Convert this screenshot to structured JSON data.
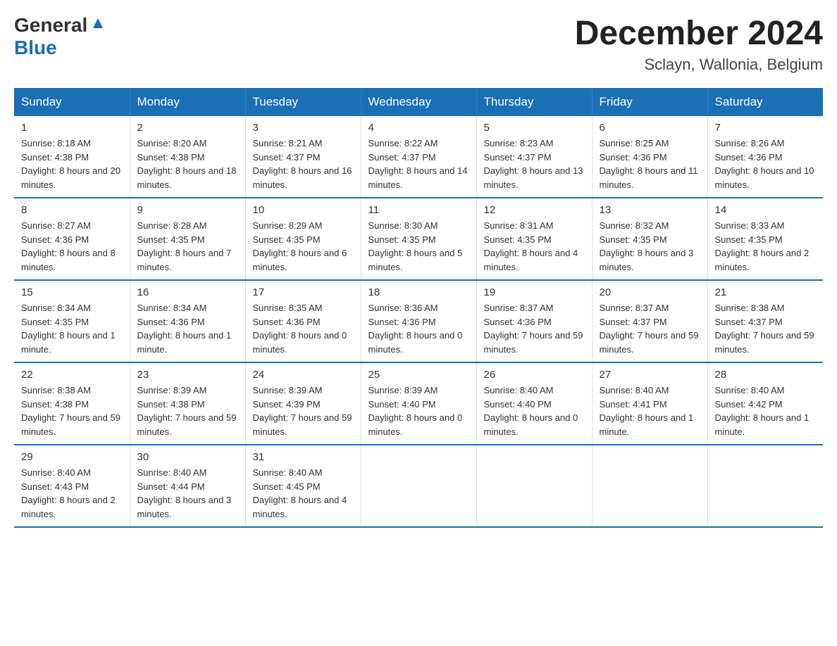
{
  "header": {
    "logo_text_general": "General",
    "logo_text_blue": "Blue",
    "month_year": "December 2024",
    "location": "Sclayn, Wallonia, Belgium"
  },
  "days_of_week": [
    "Sunday",
    "Monday",
    "Tuesday",
    "Wednesday",
    "Thursday",
    "Friday",
    "Saturday"
  ],
  "weeks": [
    [
      {
        "day": "1",
        "sunrise": "8:18 AM",
        "sunset": "4:38 PM",
        "daylight": "8 hours and 20 minutes."
      },
      {
        "day": "2",
        "sunrise": "8:20 AM",
        "sunset": "4:38 PM",
        "daylight": "8 hours and 18 minutes."
      },
      {
        "day": "3",
        "sunrise": "8:21 AM",
        "sunset": "4:37 PM",
        "daylight": "8 hours and 16 minutes."
      },
      {
        "day": "4",
        "sunrise": "8:22 AM",
        "sunset": "4:37 PM",
        "daylight": "8 hours and 14 minutes."
      },
      {
        "day": "5",
        "sunrise": "8:23 AM",
        "sunset": "4:37 PM",
        "daylight": "8 hours and 13 minutes."
      },
      {
        "day": "6",
        "sunrise": "8:25 AM",
        "sunset": "4:36 PM",
        "daylight": "8 hours and 11 minutes."
      },
      {
        "day": "7",
        "sunrise": "8:26 AM",
        "sunset": "4:36 PM",
        "daylight": "8 hours and 10 minutes."
      }
    ],
    [
      {
        "day": "8",
        "sunrise": "8:27 AM",
        "sunset": "4:36 PM",
        "daylight": "8 hours and 8 minutes."
      },
      {
        "day": "9",
        "sunrise": "8:28 AM",
        "sunset": "4:35 PM",
        "daylight": "8 hours and 7 minutes."
      },
      {
        "day": "10",
        "sunrise": "8:29 AM",
        "sunset": "4:35 PM",
        "daylight": "8 hours and 6 minutes."
      },
      {
        "day": "11",
        "sunrise": "8:30 AM",
        "sunset": "4:35 PM",
        "daylight": "8 hours and 5 minutes."
      },
      {
        "day": "12",
        "sunrise": "8:31 AM",
        "sunset": "4:35 PM",
        "daylight": "8 hours and 4 minutes."
      },
      {
        "day": "13",
        "sunrise": "8:32 AM",
        "sunset": "4:35 PM",
        "daylight": "8 hours and 3 minutes."
      },
      {
        "day": "14",
        "sunrise": "8:33 AM",
        "sunset": "4:35 PM",
        "daylight": "8 hours and 2 minutes."
      }
    ],
    [
      {
        "day": "15",
        "sunrise": "8:34 AM",
        "sunset": "4:35 PM",
        "daylight": "8 hours and 1 minute."
      },
      {
        "day": "16",
        "sunrise": "8:34 AM",
        "sunset": "4:36 PM",
        "daylight": "8 hours and 1 minute."
      },
      {
        "day": "17",
        "sunrise": "8:35 AM",
        "sunset": "4:36 PM",
        "daylight": "8 hours and 0 minutes."
      },
      {
        "day": "18",
        "sunrise": "8:36 AM",
        "sunset": "4:36 PM",
        "daylight": "8 hours and 0 minutes."
      },
      {
        "day": "19",
        "sunrise": "8:37 AM",
        "sunset": "4:36 PM",
        "daylight": "7 hours and 59 minutes."
      },
      {
        "day": "20",
        "sunrise": "8:37 AM",
        "sunset": "4:37 PM",
        "daylight": "7 hours and 59 minutes."
      },
      {
        "day": "21",
        "sunrise": "8:38 AM",
        "sunset": "4:37 PM",
        "daylight": "7 hours and 59 minutes."
      }
    ],
    [
      {
        "day": "22",
        "sunrise": "8:38 AM",
        "sunset": "4:38 PM",
        "daylight": "7 hours and 59 minutes."
      },
      {
        "day": "23",
        "sunrise": "8:39 AM",
        "sunset": "4:38 PM",
        "daylight": "7 hours and 59 minutes."
      },
      {
        "day": "24",
        "sunrise": "8:39 AM",
        "sunset": "4:39 PM",
        "daylight": "7 hours and 59 minutes."
      },
      {
        "day": "25",
        "sunrise": "8:39 AM",
        "sunset": "4:40 PM",
        "daylight": "8 hours and 0 minutes."
      },
      {
        "day": "26",
        "sunrise": "8:40 AM",
        "sunset": "4:40 PM",
        "daylight": "8 hours and 0 minutes."
      },
      {
        "day": "27",
        "sunrise": "8:40 AM",
        "sunset": "4:41 PM",
        "daylight": "8 hours and 1 minute."
      },
      {
        "day": "28",
        "sunrise": "8:40 AM",
        "sunset": "4:42 PM",
        "daylight": "8 hours and 1 minute."
      }
    ],
    [
      {
        "day": "29",
        "sunrise": "8:40 AM",
        "sunset": "4:43 PM",
        "daylight": "8 hours and 2 minutes."
      },
      {
        "day": "30",
        "sunrise": "8:40 AM",
        "sunset": "4:44 PM",
        "daylight": "8 hours and 3 minutes."
      },
      {
        "day": "31",
        "sunrise": "8:40 AM",
        "sunset": "4:45 PM",
        "daylight": "8 hours and 4 minutes."
      },
      null,
      null,
      null,
      null
    ]
  ],
  "labels": {
    "sunrise": "Sunrise:",
    "sunset": "Sunset:",
    "daylight": "Daylight:"
  }
}
